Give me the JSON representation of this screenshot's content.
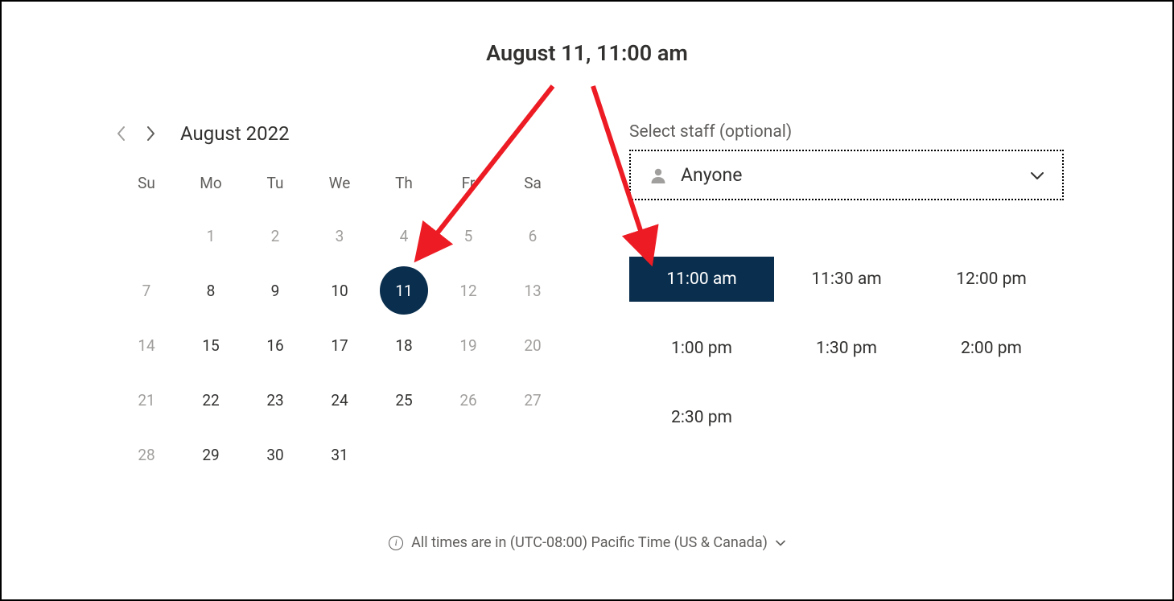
{
  "header": {
    "title": "August 11, 11:00 am"
  },
  "calendar": {
    "month_label": "August 2022",
    "weekdays": [
      "Su",
      "Mo",
      "Tu",
      "We",
      "Th",
      "Fr",
      "Sa"
    ],
    "weeks": [
      [
        null,
        {
          "n": "1",
          "disabled": true
        },
        {
          "n": "2",
          "disabled": true
        },
        {
          "n": "3",
          "disabled": true
        },
        {
          "n": "4",
          "disabled": true
        },
        {
          "n": "5",
          "disabled": true
        },
        {
          "n": "6",
          "disabled": true
        }
      ],
      [
        {
          "n": "7",
          "disabled": true
        },
        {
          "n": "8"
        },
        {
          "n": "9"
        },
        {
          "n": "10"
        },
        {
          "n": "11",
          "selected": true
        },
        {
          "n": "12",
          "disabled": true
        },
        {
          "n": "13",
          "disabled": true
        }
      ],
      [
        {
          "n": "14",
          "disabled": true
        },
        {
          "n": "15"
        },
        {
          "n": "16"
        },
        {
          "n": "17"
        },
        {
          "n": "18"
        },
        {
          "n": "19",
          "disabled": true
        },
        {
          "n": "20",
          "disabled": true
        }
      ],
      [
        {
          "n": "21",
          "disabled": true
        },
        {
          "n": "22"
        },
        {
          "n": "23"
        },
        {
          "n": "24"
        },
        {
          "n": "25"
        },
        {
          "n": "26",
          "disabled": true
        },
        {
          "n": "27",
          "disabled": true
        }
      ],
      [
        {
          "n": "28",
          "disabled": true
        },
        {
          "n": "29"
        },
        {
          "n": "30"
        },
        {
          "n": "31"
        },
        null,
        null,
        null
      ]
    ]
  },
  "staff": {
    "label": "Select staff (optional)",
    "selected": "Anyone"
  },
  "timeslots": [
    {
      "label": "11:00 am",
      "selected": true
    },
    {
      "label": "11:30 am"
    },
    {
      "label": "12:00 pm"
    },
    {
      "label": "1:00 pm"
    },
    {
      "label": "1:30 pm"
    },
    {
      "label": "2:00 pm"
    },
    {
      "label": "2:30 pm"
    }
  ],
  "footer": {
    "text": "All times are in  (UTC-08:00) Pacific Time (US & Canada)"
  },
  "annotation": {
    "arrow_color": "#ed1c24"
  }
}
